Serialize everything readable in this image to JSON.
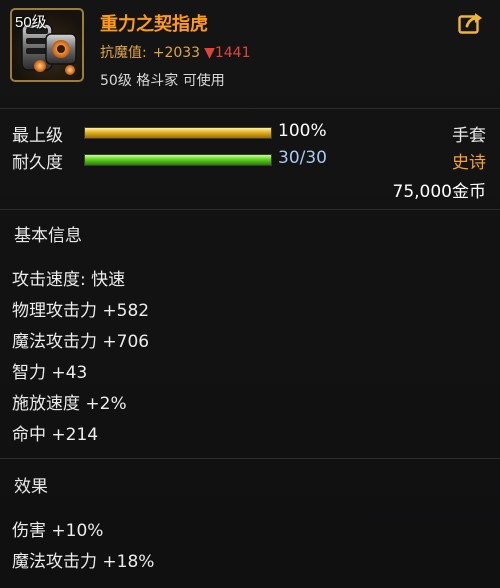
{
  "item": {
    "level_badge": "50级",
    "name": "重力之契指虎",
    "resist_label": "抗魔值:",
    "resist_up": "+2033",
    "resist_down_arrow": "▼",
    "resist_down": "1441",
    "requirement": "50级 格斗家 可使用"
  },
  "stats": {
    "upgrade_label": "最上级",
    "upgrade_value": "100%",
    "upgrade_fraction": 1.0,
    "durability_label": "耐久度",
    "durability_value": "30/30",
    "durability_fraction": 1.0,
    "item_type": "手套",
    "rarity": "史诗",
    "price": "75,000金币"
  },
  "basic_info": {
    "title": "基本信息",
    "lines": [
      "攻击速度: 快速",
      "物理攻击力 +582",
      "魔法攻击力 +706",
      "智力 +43",
      "施放速度 +2%",
      "命中 +214"
    ]
  },
  "effects": {
    "title": "效果",
    "lines": [
      "伤害 +10%",
      "魔法攻击力 +18%"
    ]
  },
  "colors": {
    "item_name": "#ff9a1a",
    "rarity": "#f3a62b",
    "resist_down": "#e0453a",
    "upgrade_bar": "#e0b020",
    "durability_bar": "#5ed21e"
  },
  "icons": {
    "item_icon": "knuckle-gauntlet-icon",
    "share": "share-arrow-icon"
  }
}
